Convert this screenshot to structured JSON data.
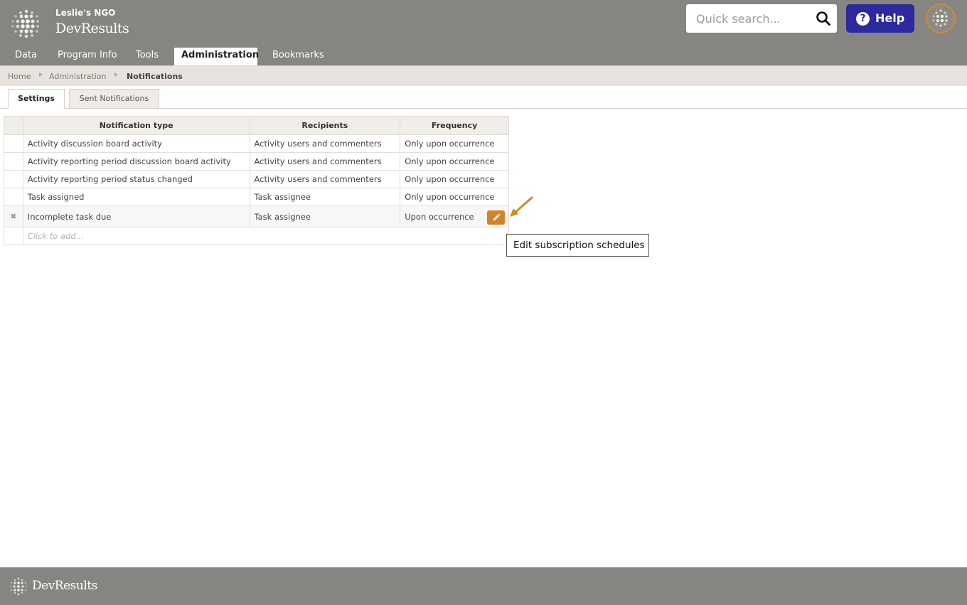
{
  "header": {
    "org_name": "Leslie's NGO",
    "brand": "DevResults",
    "search_placeholder": "Quick search...",
    "help_label": "Help",
    "colors": {
      "bar": "#878581",
      "help": "#2c2a9e",
      "accent": "#d4822a"
    }
  },
  "nav": {
    "items": [
      {
        "label": "Data"
      },
      {
        "label": "Program Info"
      },
      {
        "label": "Tools"
      },
      {
        "label": "Administration",
        "active": true
      },
      {
        "label": "Bookmarks"
      }
    ]
  },
  "breadcrumb": {
    "items": [
      "Home",
      "Administration",
      "Notifications"
    ]
  },
  "tabs": [
    {
      "label": "Settings",
      "active": true
    },
    {
      "label": "Sent Notifications",
      "active": false
    }
  ],
  "table": {
    "headers": [
      "Notification type",
      "Recipients",
      "Frequency"
    ],
    "rows": [
      {
        "type": "Activity discussion board activity",
        "recipients": "Activity users and commenters",
        "frequency": "Only upon occurrence"
      },
      {
        "type": "Activity reporting period discussion board activity",
        "recipients": "Activity users and commenters",
        "frequency": "Only upon occurrence"
      },
      {
        "type": "Activity reporting period status changed",
        "recipients": "Activity users and commenters",
        "frequency": "Only upon occurrence"
      },
      {
        "type": "Task assigned",
        "recipients": "Task assignee",
        "frequency": "Only upon occurrence"
      },
      {
        "type": "Incomplete task due",
        "recipients": "Task assignee",
        "frequency": "Upon occurrence",
        "selected_mark": "✖"
      }
    ],
    "add_placeholder": "Click to add..."
  },
  "tooltip": {
    "text": "Edit subscription schedules"
  },
  "footer": {
    "brand": "DevResults"
  },
  "icons": {
    "logo": "globe-logo-icon",
    "search": "search-icon",
    "help": "question-circle-icon",
    "edit": "pencil-icon",
    "delete": "close-icon"
  }
}
